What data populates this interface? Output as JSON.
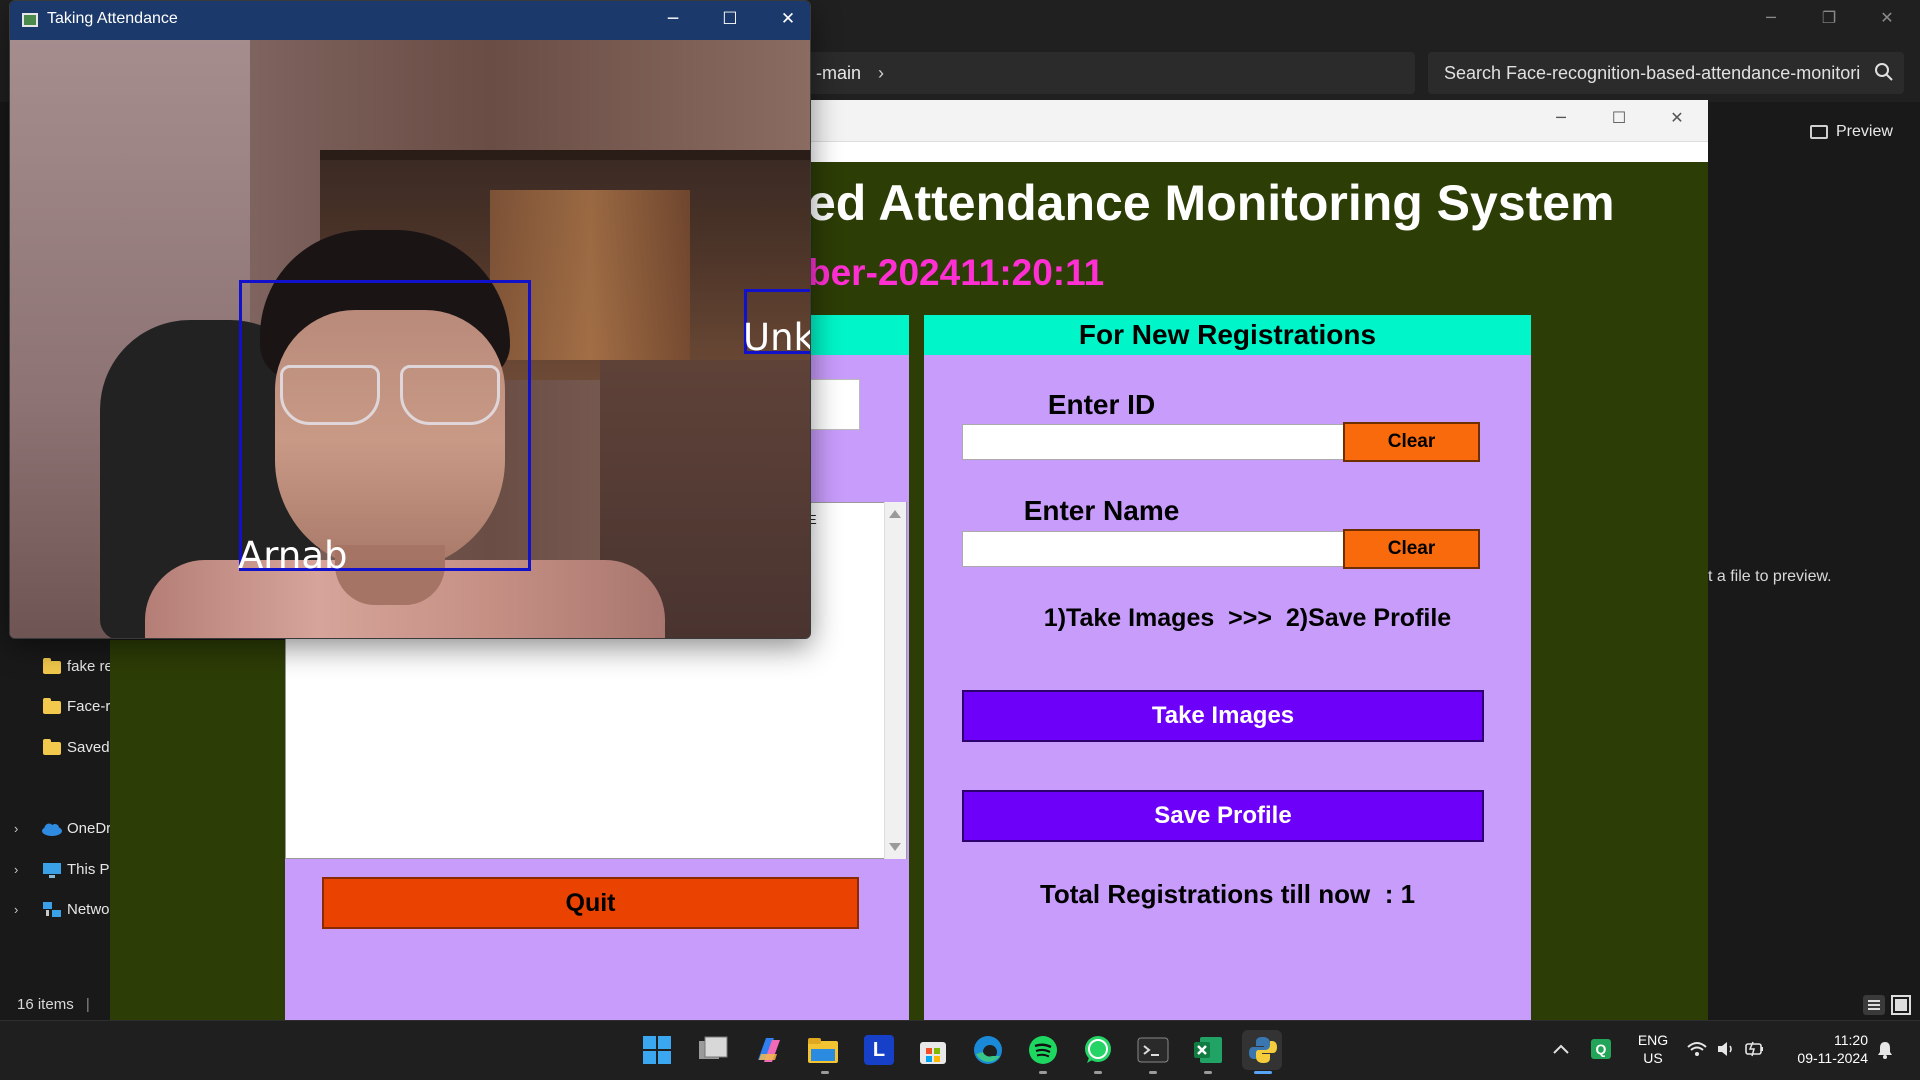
{
  "explorer": {
    "address_tail": "-main",
    "search_placeholder": "Search Face-recognition-based-attendance-monitori",
    "preview_label": "Preview",
    "preview_hint": "t a file to preview.",
    "nav": {
      "folder1": "fake re",
      "folder2": "Face-r",
      "folder3": "Saved",
      "onedrive": "OneDr",
      "this_pc": "This P",
      "network": "Netwo"
    },
    "status_items": "16 items"
  },
  "attendance_app": {
    "heading": "ed Attendance Monitoring System",
    "clock": "ber-202411:20:11",
    "listbox_cut": "E",
    "quit_label": "Quit",
    "registration": {
      "header": "For New Registrations",
      "enter_id_label": "Enter ID",
      "enter_name_label": "Enter Name",
      "clear_id_label": "Clear",
      "clear_name_label": "Clear",
      "id_value": "",
      "name_value": "",
      "steps_text": "1)Take Images  >>>  2)Save Profile",
      "take_images_label": "Take Images",
      "save_profile_label": "Save Profile",
      "total_text": "Total Registrations till now  : 1"
    }
  },
  "camera_window": {
    "title": "Taking Attendance",
    "face_label_1": "Arnab",
    "face_label_2": "Unk",
    "box_color": "#1111cc"
  },
  "taskbar": {
    "apps": [
      "start-icon",
      "task-view-icon",
      "copilot-icon",
      "file-explorer-icon",
      "l-app-icon",
      "microsoft-store-icon",
      "edge-icon",
      "spotify-icon",
      "whatsapp-icon",
      "terminal-icon",
      "excel-icon",
      "python-icon"
    ],
    "lang_line1": "ENG",
    "lang_line2": "US",
    "time": "11:20",
    "date": "09-11-2024"
  },
  "colors": {
    "app_background": "#2d3d06",
    "panel_purple": "#c79cfa",
    "header_cyan": "#00f5c8",
    "clock_magenta": "#ff2fd3",
    "button_purple": "#6d00f9",
    "button_orange": "#f96a0c",
    "quit_red": "#ea4200"
  }
}
